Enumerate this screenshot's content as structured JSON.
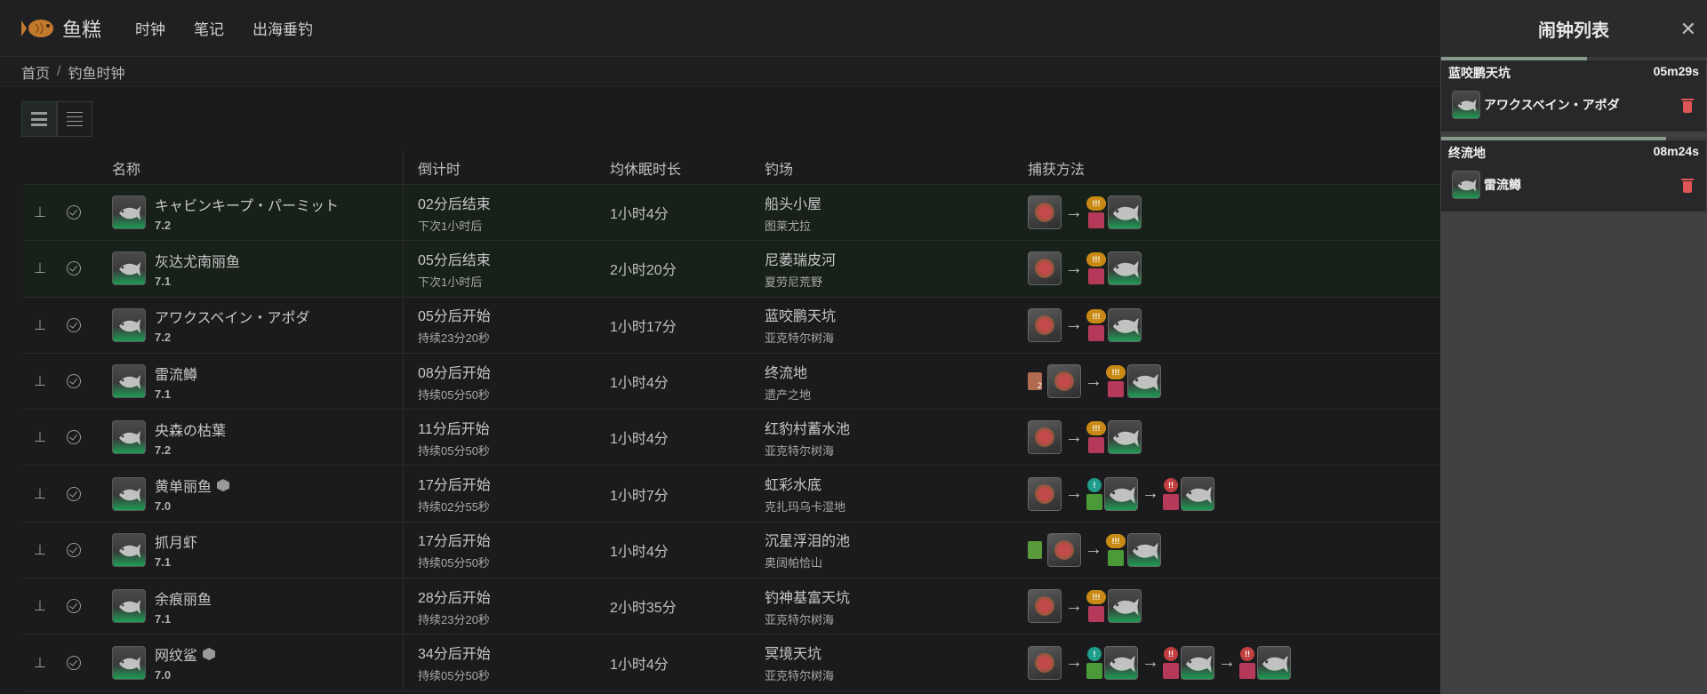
{
  "app": {
    "logo_text": "鱼糕"
  },
  "nav": [
    "时钟",
    "笔记",
    "出海垂钓"
  ],
  "breadcrumb": [
    "首页",
    "钓鱼时钟"
  ],
  "table": {
    "headers": {
      "name": "名称",
      "countdown": "倒计时",
      "dur": "均休眠时长",
      "spot": "钓场",
      "method": "捕获方法"
    },
    "rows": [
      {
        "name": "キャビンキープ・パーミット",
        "ver": "7.2",
        "time": "02分后结束",
        "sub": "下次1小时后",
        "dur": "1小时4分",
        "spot": "船头小屋",
        "area": "图莱尤拉",
        "active": true,
        "cube": false
      },
      {
        "name": "灰达尤南丽鱼",
        "ver": "7.1",
        "time": "05分后结束",
        "sub": "下次1小时后",
        "dur": "2小时20分",
        "spot": "尼萎瑞皮河",
        "area": "夏劳尼荒野",
        "active": true,
        "cube": false
      },
      {
        "name": "アワクスベイン・アポダ",
        "ver": "7.2",
        "time": "05分后开始",
        "sub": "持续23分20秒",
        "dur": "1小时17分",
        "spot": "蓝咬鹏天坑",
        "area": "亚克特尔树海",
        "active": false,
        "cube": false
      },
      {
        "name": "雷流鳟",
        "ver": "7.1",
        "time": "08分后开始",
        "sub": "持续05分50秒",
        "dur": "1小时4分",
        "spot": "终流地",
        "area": "遗产之地",
        "active": false,
        "cube": false
      },
      {
        "name": "央森の枯葉",
        "ver": "7.2",
        "time": "11分后开始",
        "sub": "持续05分50秒",
        "dur": "1小时4分",
        "spot": "红豹村蓄水池",
        "area": "亚克特尔树海",
        "active": false,
        "cube": false
      },
      {
        "name": "黄单丽鱼",
        "ver": "7.0",
        "time": "17分后开始",
        "sub": "持续02分55秒",
        "dur": "1小时7分",
        "spot": "虹彩水底",
        "area": "克扎玛乌卡湿地",
        "active": false,
        "cube": true
      },
      {
        "name": "抓月虾",
        "ver": "7.1",
        "time": "17分后开始",
        "sub": "持续05分50秒",
        "dur": "1小时4分",
        "spot": "沉星浮泪的池",
        "area": "奥阔帕恰山",
        "active": false,
        "cube": false
      },
      {
        "name": "余痕丽鱼",
        "ver": "7.1",
        "time": "28分后开始",
        "sub": "持续23分20秒",
        "dur": "2小时35分",
        "spot": "钓神基富天坑",
        "area": "亚克特尔树海",
        "active": false,
        "cube": false
      },
      {
        "name": "网纹鲨",
        "ver": "7.0",
        "time": "34分后开始",
        "sub": "持续05分50秒",
        "dur": "1小时4分",
        "spot": "冥境天坑",
        "area": "亚克特尔树海",
        "active": false,
        "cube": true
      }
    ]
  },
  "tug": {
    "heavy": "!!!",
    "medium": "!!",
    "light": "!"
  },
  "small_bait_count": "2",
  "panel": {
    "title": "闹钟列表",
    "alarms": [
      {
        "spot": "蓝咬鹏天坑",
        "time": "05m29s",
        "fish": "アワクスベイン・アポダ",
        "progress": 0.55
      },
      {
        "spot": "终流地",
        "time": "08m24s",
        "fish": "雷流鳟",
        "progress": 0.85
      }
    ]
  },
  "colors": {
    "accent_green": "#1e9c54",
    "danger": "#e05555",
    "active_row": "#172019"
  }
}
